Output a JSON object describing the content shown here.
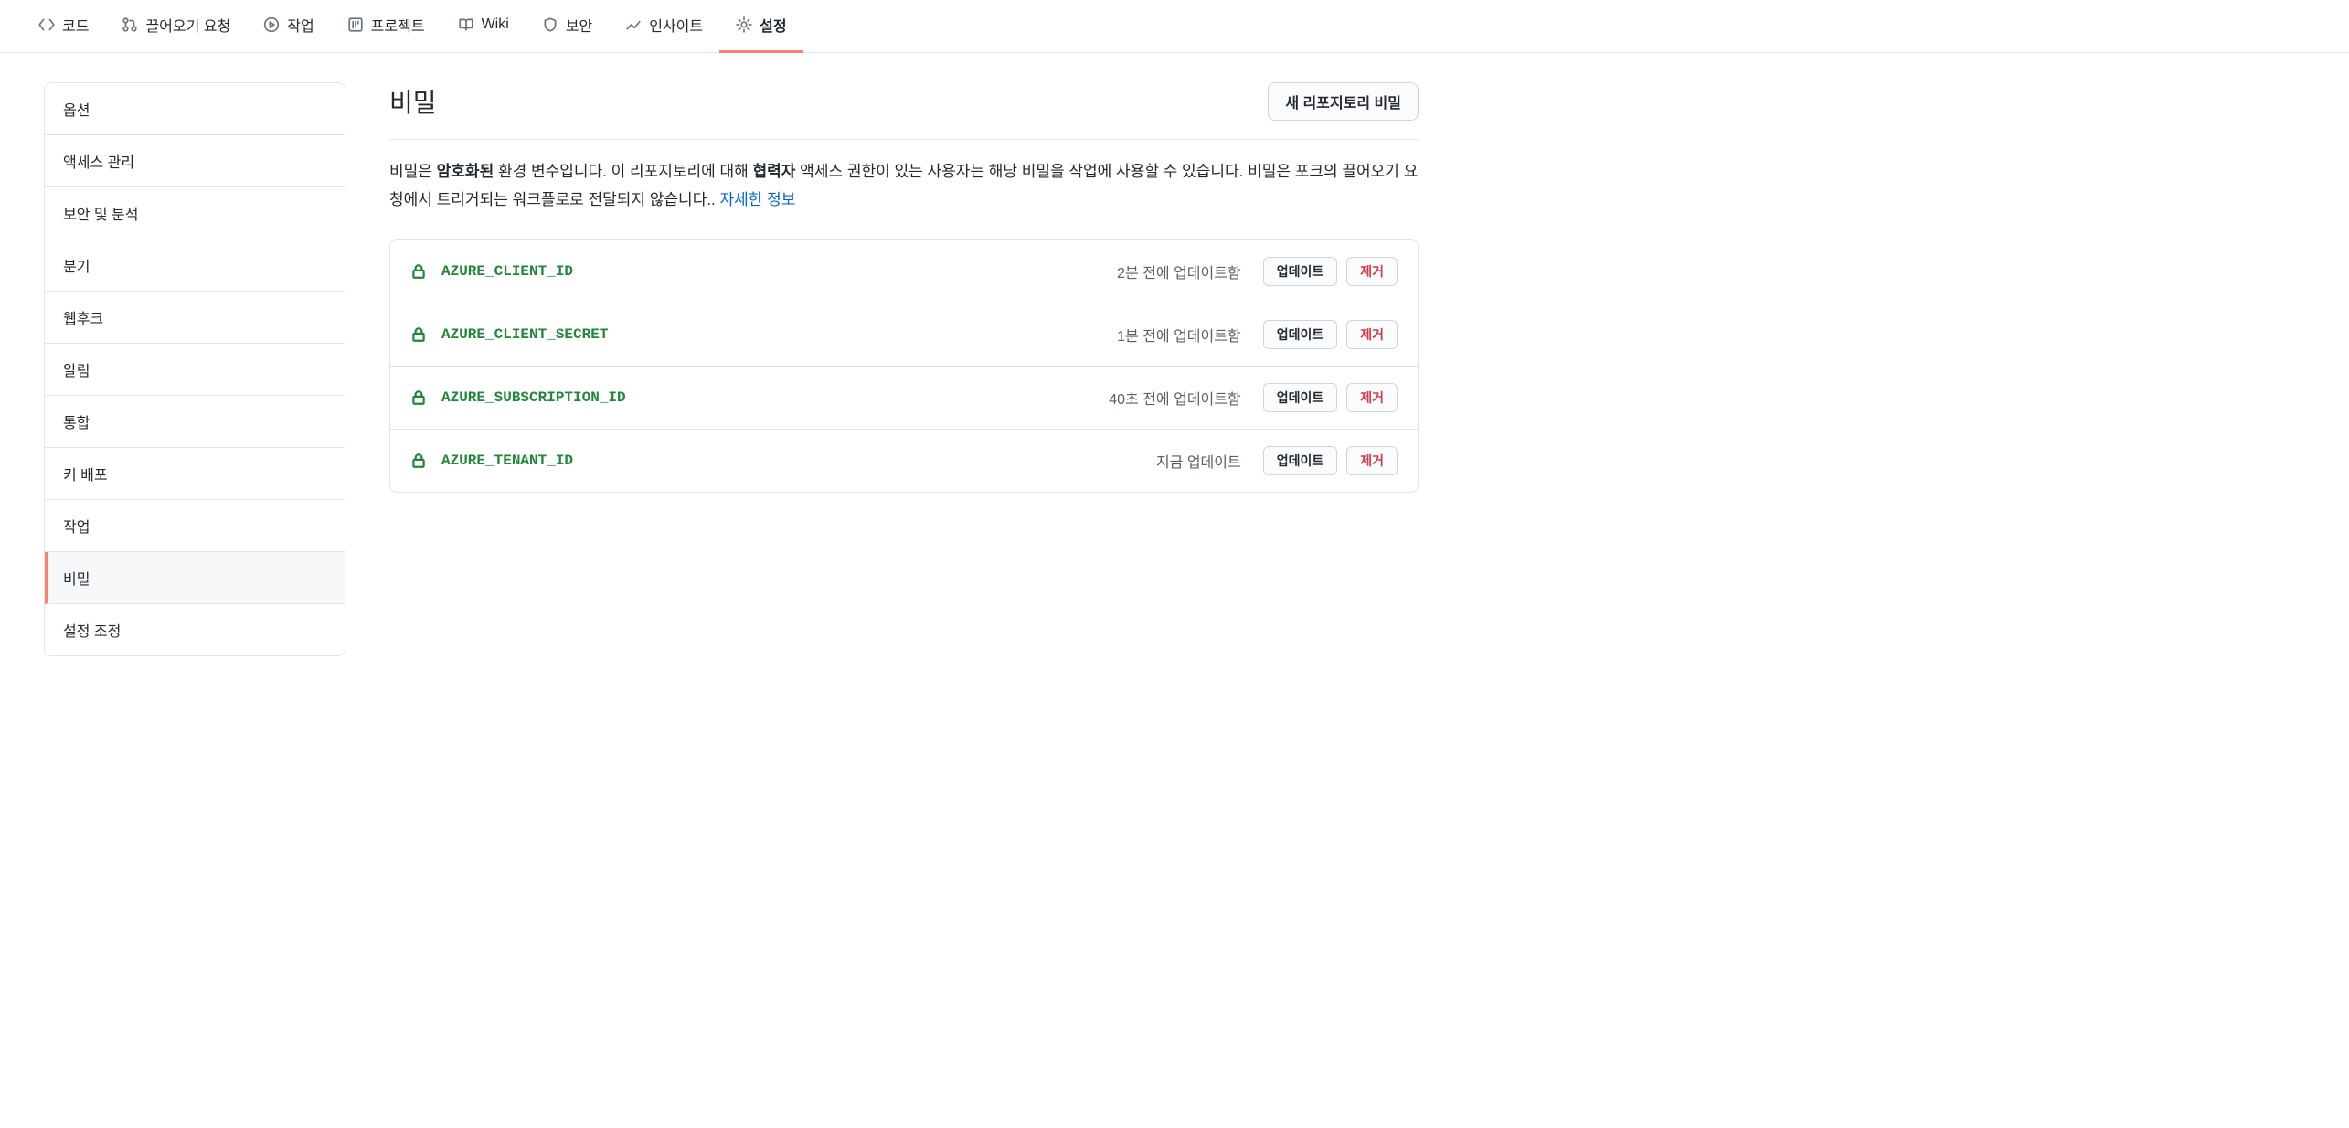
{
  "top_nav": [
    {
      "label": "코드",
      "icon": "code"
    },
    {
      "label": "끌어오기 요청",
      "icon": "git-pull"
    },
    {
      "label": "작업",
      "icon": "play-circle"
    },
    {
      "label": "프로젝트",
      "icon": "project"
    },
    {
      "label": "Wiki",
      "icon": "book"
    },
    {
      "label": "보안",
      "icon": "shield"
    },
    {
      "label": "인사이트",
      "icon": "graph"
    },
    {
      "label": "설정",
      "icon": "gear",
      "active": true
    }
  ],
  "sidebar": {
    "items": [
      {
        "label": "옵션"
      },
      {
        "label": "액세스 관리"
      },
      {
        "label": "보안 및 분석"
      },
      {
        "label": "분기"
      },
      {
        "label": "웹후크"
      },
      {
        "label": "알림"
      },
      {
        "label": "통합"
      },
      {
        "label": "키 배포"
      },
      {
        "label": "작업"
      },
      {
        "label": "비밀",
        "active": true
      },
      {
        "label": "설정 조정"
      }
    ]
  },
  "header": {
    "title": "비밀",
    "new_button": "새 리포지토리 비밀"
  },
  "description": {
    "text_1": "비밀은 ",
    "bold_1": "암호화된",
    "text_2": " 환경 변수입니다. 이 리포지토리에 대해 ",
    "bold_2": "협력자",
    "text_3": " 액세스 권한이 있는 사용자는 해당 비밀을 작업에 사용할 수 있습니다. 비밀은 포크의 끌어오기 요청에서 트리거되는 워크플로로 전달되지 않습니다.. ",
    "link": "자세한 정보"
  },
  "secrets": [
    {
      "name": "AZURE_CLIENT_ID",
      "updated": "2분 전에 업데이트함"
    },
    {
      "name": "AZURE_CLIENT_SECRET",
      "updated": "1분 전에 업데이트함"
    },
    {
      "name": "AZURE_SUBSCRIPTION_ID",
      "updated": "40초 전에 업데이트함"
    },
    {
      "name": "AZURE_TENANT_ID",
      "updated": "지금 업데이트"
    }
  ],
  "buttons": {
    "update": "업데이트",
    "remove": "제거"
  }
}
